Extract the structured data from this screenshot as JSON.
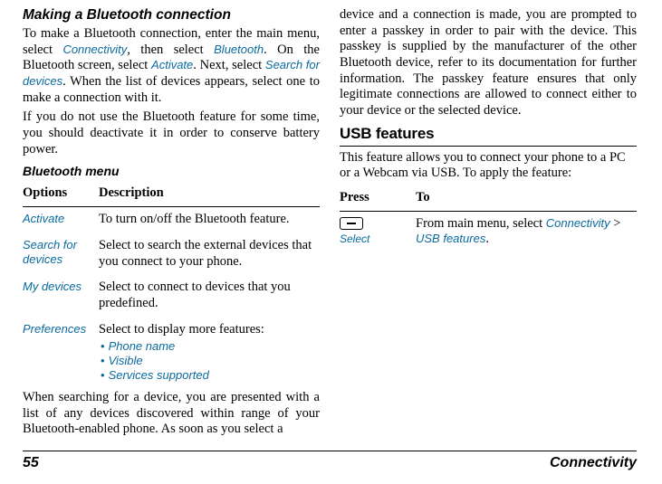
{
  "left": {
    "h1": "Making a Bluetooth connection",
    "p1a": "To make a Bluetooth connection, enter the main menu, select ",
    "t_conn": "Connectivity",
    "p1b": ", then select ",
    "t_bt": "Bluetooth",
    "p1c": ". On the Bluetooth screen, select ",
    "t_act": "Activate",
    "p1d": ". Next, select ",
    "t_sfd": "Search for devices",
    "p1e": ". When the list of devices appears, select one to make a connection with it.",
    "p2": "If you do not use the Bluetooth feature for some time, you should deactivate it in order to conserve battery power.",
    "sub": "Bluetooth menu",
    "th_opt": "Options",
    "th_desc": "Description",
    "rows": [
      {
        "opt": "Activate",
        "desc": "To turn on/off the Bluetooth feature."
      },
      {
        "opt": "Search for devices",
        "desc": "Select to search the external devices that you connect to your phone."
      },
      {
        "opt": "My devices",
        "desc": "Select to connect to devices that you predefined."
      }
    ],
    "pref_opt": "Preferences",
    "pref_desc": "Select to display more features:",
    "pref_items": [
      "Phone name",
      "Visible",
      "Services supported"
    ],
    "p3": "When searching for a device, you are presented with a list of any devices discovered within range of your Bluetooth-enabled phone. As soon as you select a"
  },
  "right": {
    "p1": "device and a connection is made, you are prompted to enter a passkey in order to pair with the device. This passkey is supplied by the manufacturer of the other Bluetooth device, refer to its documentation for further information. The passkey feature ensures that only legitimate connections are allowed to connect either to your device or the selected device.",
    "h2": "USB features",
    "p2": "This feature allows you to connect your phone to a PC or a Webcam via USB. To apply the feature:",
    "th_press": "Press",
    "th_to": "To",
    "select": "Select",
    "to_a": "From main menu, select ",
    "to_conn": "Connectivity",
    "to_b": " > ",
    "to_usb": "USB features",
    "to_c": "."
  },
  "footer": {
    "page": "55",
    "section": "Connectivity"
  }
}
